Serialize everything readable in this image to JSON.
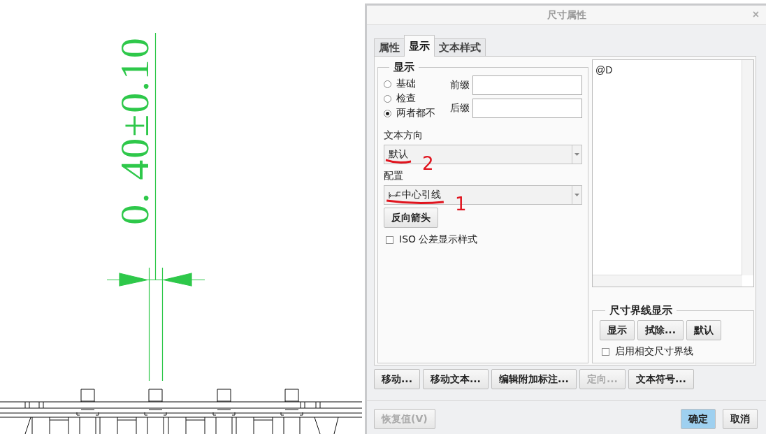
{
  "canvas": {
    "dimension_text": "0. 40±0.10"
  },
  "dialog": {
    "title": "尺寸属性",
    "close": "×",
    "tabs": [
      {
        "label": "属性",
        "selected": false
      },
      {
        "label": "显示",
        "selected": true
      },
      {
        "label": "文本样式",
        "selected": false
      }
    ],
    "display_group": {
      "legend": "显示",
      "options": [
        {
          "label": "基础",
          "selected": false
        },
        {
          "label": "检查",
          "selected": false
        },
        {
          "label": "两者都不",
          "selected": true
        }
      ],
      "prefix": {
        "label": "前缀"
      },
      "suffix": {
        "label": "后缀"
      }
    },
    "text_direction": {
      "label": "文本方向",
      "value": "默认",
      "annotation": "2"
    },
    "configuration": {
      "label": "配置",
      "value": "中心引线",
      "annotation": "1"
    },
    "reverse_button": "反向箭头",
    "iso_checkbox": {
      "label": "ISO 公差显示样式",
      "checked": false
    },
    "text_area": {
      "value": "@D"
    },
    "witness_group": {
      "legend": "尺寸界线显示",
      "buttons": [
        "显示",
        "拭除...",
        "默认"
      ],
      "checkbox": {
        "label": "启用相交尺寸界线",
        "checked": false
      }
    },
    "action_buttons": [
      {
        "label": "移动...",
        "disabled": false
      },
      {
        "label": "移动文本...",
        "disabled": false
      },
      {
        "label": "编辑附加标注...",
        "disabled": false
      },
      {
        "label": "定向...",
        "disabled": true
      },
      {
        "label": "文本符号...",
        "disabled": false
      }
    ],
    "footer": {
      "restore": {
        "label": "恢复值(V)",
        "disabled": true
      },
      "buttons": [
        {
          "label": "确定",
          "default": true
        },
        {
          "label": "取消",
          "default": false
        }
      ]
    }
  }
}
